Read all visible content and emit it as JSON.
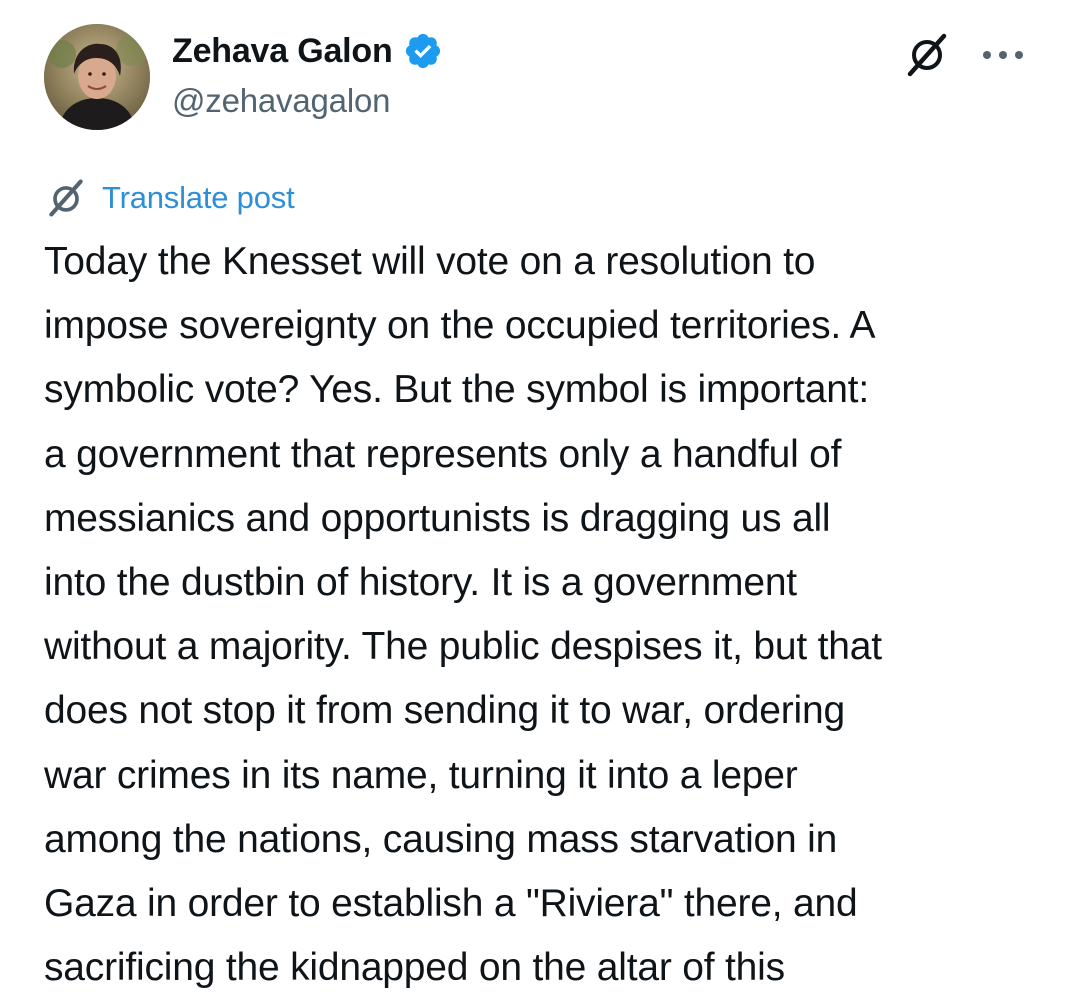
{
  "post": {
    "author": {
      "display_name": "Zehava Galon",
      "handle": "@zehavagalon",
      "verified": true,
      "verified_color": "#1d9bf0"
    },
    "actions": {
      "grok_icon": "grok-slash-icon",
      "more_icon": "more-dots-icon"
    },
    "translate": {
      "label": "Translate post",
      "icon": "grok-slash-icon",
      "color": "#2f8fd6"
    },
    "body_lines": [
      "Today the Knesset will vote on a resolution to",
      "impose sovereignty on the occupied territories. A",
      "symbolic vote? Yes. But the symbol is important:",
      "a government that represents only a handful of",
      "messianics and opportunists is dragging us all",
      "into the dustbin of history. It is a government",
      "without a majority. The public despises it, but that",
      "does not stop it from sending it to war, ordering",
      "war crimes in its name, turning it into a leper",
      "among the nations, causing mass starvation in",
      "Gaza in order to establish a \"Riviera\" there, and",
      "sacrificing the kidnapped on the altar of this"
    ]
  }
}
